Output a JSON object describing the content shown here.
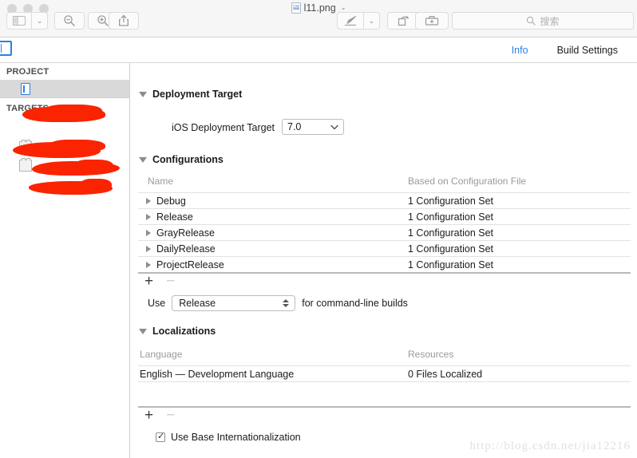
{
  "window": {
    "document_title": "l11.png",
    "title_chevron": "⌄",
    "traffic_lights": [
      "close",
      "minimize",
      "zoom"
    ]
  },
  "toolbar": {
    "sidebar_button": "sidebar-view",
    "sidebar_chevron": "⌄",
    "zoom_out": "zoom-out",
    "zoom_in": "zoom-in",
    "share": "share",
    "markup": "markup-pen",
    "markup_chevron": "⌄",
    "rotate": "rotate-left",
    "toolbox": "markup-toolbox",
    "search_placeholder": "搜索"
  },
  "editor": {
    "tabs": [
      {
        "label": "Info",
        "active": true
      },
      {
        "label": "Build Settings",
        "active": false
      }
    ],
    "sidebar": {
      "project_header": "PROJECT",
      "targets_header": "TARGETS",
      "project_items": [
        {
          "label": "",
          "redacted": true,
          "selected": true
        }
      ],
      "target_items": [
        {
          "label": "",
          "redacted": true,
          "has_icon": false
        },
        {
          "label": "",
          "redacted": true,
          "has_icon": true
        },
        {
          "label": "",
          "redacted": true,
          "has_icon": true
        }
      ]
    },
    "deployment_target": {
      "section_title": "Deployment Target",
      "field_label": "iOS Deployment Target",
      "value": "7.0"
    },
    "configurations": {
      "section_title": "Configurations",
      "columns": [
        "Name",
        "Based on Configuration File"
      ],
      "rows": [
        {
          "name": "Debug",
          "based_on": "1 Configuration Set"
        },
        {
          "name": "Release",
          "based_on": "1 Configuration Set"
        },
        {
          "name": "GrayRelease",
          "based_on": "1 Configuration Set"
        },
        {
          "name": "DailyRelease",
          "based_on": "1 Configuration Set"
        },
        {
          "name": "ProjectRelease",
          "based_on": "1 Configuration Set"
        }
      ],
      "add_button": "+",
      "remove_button": "−",
      "command_line_prefix": "Use",
      "command_line_value": "Release",
      "command_line_suffix": "for command-line builds"
    },
    "localizations": {
      "section_title": "Localizations",
      "columns": [
        "Language",
        "Resources"
      ],
      "rows": [
        {
          "language": "English — Development Language",
          "resources": "0 Files Localized"
        }
      ],
      "add_button": "+",
      "remove_button": "−",
      "base_internationalization_label": "Use Base Internationalization",
      "base_internationalization_checked": true
    }
  },
  "watermark": {
    "text": "http://blog.csdn.net/jia12216"
  },
  "colors": {
    "accent_blue": "#2a7fe8",
    "redaction_red": "#fa2400",
    "selected_row": "#d9d9d9",
    "chrome_bg": "#f6f6f6"
  }
}
